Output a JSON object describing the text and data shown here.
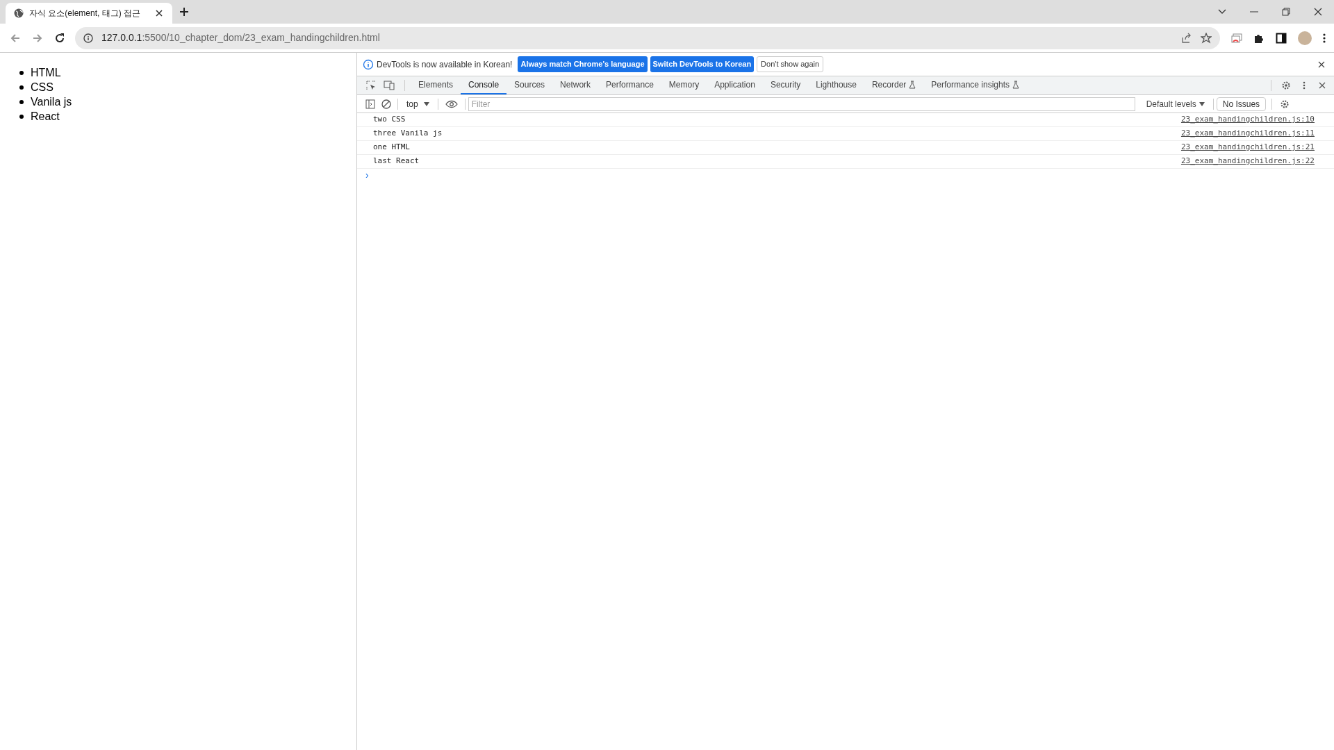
{
  "browser": {
    "tabs": [
      {
        "title": "자식 요소(element, 태그) 접근",
        "selected": true
      }
    ],
    "address": {
      "host": "127.0.0.1",
      "path": ":5500/10_chapter_dom/23_exam_handingchildren.html"
    }
  },
  "page": {
    "list_items": [
      "HTML",
      "CSS",
      "Vanila js",
      "React"
    ]
  },
  "devtools": {
    "infobar": {
      "message": "DevTools is now available in Korean!",
      "buttons": [
        {
          "label": "Always match Chrome's language",
          "kind": "primary"
        },
        {
          "label": "Switch DevTools to Korean",
          "kind": "primary"
        },
        {
          "label": "Don't show again",
          "kind": "secondary"
        }
      ]
    },
    "tabs": [
      {
        "label": "Elements",
        "selected": false,
        "experimental": false
      },
      {
        "label": "Console",
        "selected": true,
        "experimental": false
      },
      {
        "label": "Sources",
        "selected": false,
        "experimental": false
      },
      {
        "label": "Network",
        "selected": false,
        "experimental": false
      },
      {
        "label": "Performance",
        "selected": false,
        "experimental": false
      },
      {
        "label": "Memory",
        "selected": false,
        "experimental": false
      },
      {
        "label": "Application",
        "selected": false,
        "experimental": false
      },
      {
        "label": "Security",
        "selected": false,
        "experimental": false
      },
      {
        "label": "Lighthouse",
        "selected": false,
        "experimental": false
      },
      {
        "label": "Recorder",
        "selected": false,
        "experimental": true
      },
      {
        "label": "Performance insights",
        "selected": false,
        "experimental": true
      }
    ],
    "toolbar": {
      "context": "top",
      "filter_placeholder": "Filter",
      "levels": "Default levels",
      "issues": "No Issues"
    },
    "messages": [
      {
        "text": "two CSS",
        "source": "23_exam_handingchildren.js:10"
      },
      {
        "text": "three Vanila js",
        "source": "23_exam_handingchildren.js:11"
      },
      {
        "text": "one HTML",
        "source": "23_exam_handingchildren.js:21"
      },
      {
        "text": "last React",
        "source": "23_exam_handingchildren.js:22"
      }
    ],
    "prompt": "›"
  }
}
